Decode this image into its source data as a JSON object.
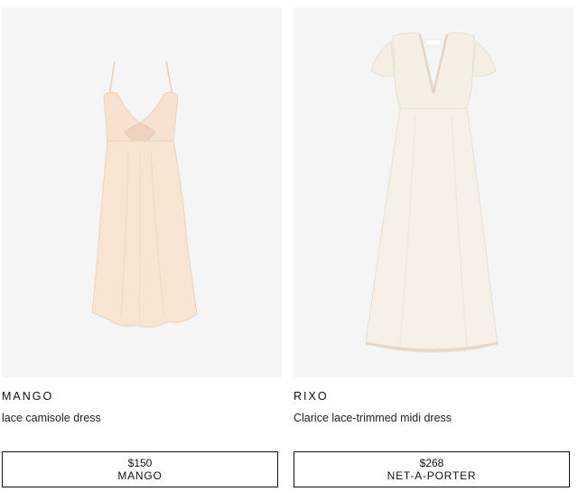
{
  "products": [
    {
      "brand": "MANGO",
      "name": "lace camisole dress",
      "price": "$150",
      "retailer": "MANGO",
      "image_icon": "camisole-dress-image",
      "dress_color": "#f7e3d2"
    },
    {
      "brand": "RIXO",
      "name": "Clarice lace-trimmed midi dress",
      "price": "$268",
      "retailer": "NET-A-PORTER",
      "image_icon": "midi-dress-image",
      "dress_color": "#f5efe6"
    }
  ]
}
